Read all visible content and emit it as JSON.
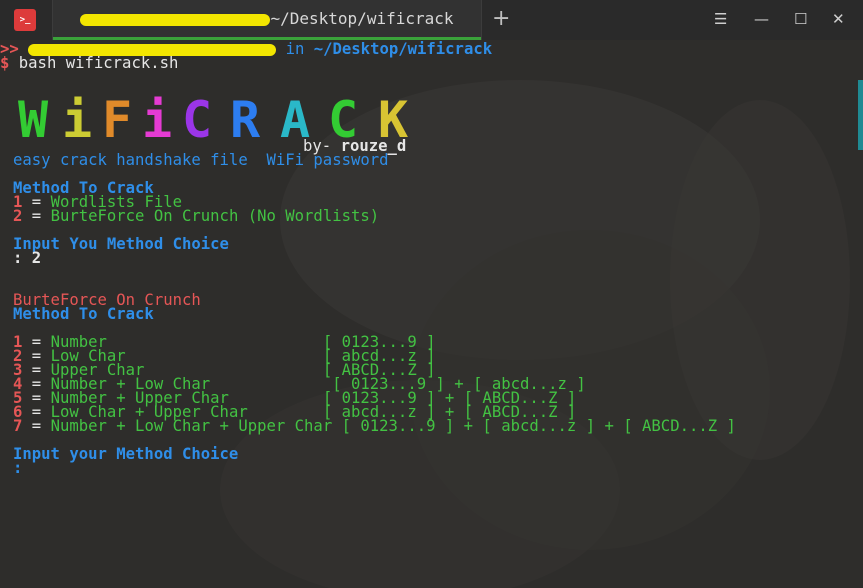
{
  "titlebar": {
    "tab_title": "~/Desktop/wificrack",
    "new_tab_symbol": "+",
    "controls": {
      "menu": "☰",
      "minimize": "—",
      "maximize": "☐",
      "close": "✕"
    }
  },
  "prompt": {
    "arrows": ">>",
    "in_word": "in",
    "path": "~/Desktop/wificrack",
    "dollar": "$",
    "command": "bash wificrack.sh"
  },
  "banner": {
    "letters": [
      "W",
      "i",
      "F",
      "i",
      "C",
      "R",
      "A",
      "C",
      "K"
    ],
    "letter_colors": [
      "#33cc33",
      "#cccc33",
      "#e08a2a",
      "#e53bd3",
      "#9b35e8",
      "#2d7df0",
      "#2ab8c8",
      "#33cc33",
      "#d8c433"
    ],
    "byline_prefix": "by-",
    "author": "rouze_d",
    "tagline": "easy crack handshake file  WiFi password"
  },
  "menu1": {
    "heading": "Method To Crack",
    "options": [
      {
        "num": "1",
        "eq": " = ",
        "label": "Wordlists File"
      },
      {
        "num": "2",
        "eq": " = ",
        "label": "BurteForce On Crunch (No Wordlists)"
      }
    ],
    "input_prompt": "Input You Method Choice",
    "input_value": ": 2"
  },
  "menu2": {
    "title": "BurteForce On Crunch",
    "heading": "Method To Crack",
    "options": [
      {
        "num": "1",
        "eq": " = ",
        "label": "Number                       ",
        "sets": "[ 0123...9 ]"
      },
      {
        "num": "2",
        "eq": " = ",
        "label": "Low Char                     ",
        "sets": "[ abcd...z ]"
      },
      {
        "num": "3",
        "eq": " = ",
        "label": "Upper Char                   ",
        "sets": "[ ABCD...Z ]"
      },
      {
        "num": "4",
        "eq": " = ",
        "label": "Number + Low Char             ",
        "sets": "[ 0123...9 ] + [ abcd...z ]"
      },
      {
        "num": "5",
        "eq": " = ",
        "label": "Number + Upper Char          ",
        "sets": "[ 0123...9 ] + [ ABCD...Z ]"
      },
      {
        "num": "6",
        "eq": " = ",
        "label": "Low Char + Upper Char        ",
        "sets": "[ abcd...z ] + [ ABCD...Z ]"
      },
      {
        "num": "7",
        "eq": " = ",
        "label": "Number + Low Char + Upper Char ",
        "sets": "[ 0123...9 ] + [ abcd...z ] + [ ABCD...Z ]"
      }
    ],
    "input_prompt": "Input your Method Choice",
    "input_value": ":"
  }
}
